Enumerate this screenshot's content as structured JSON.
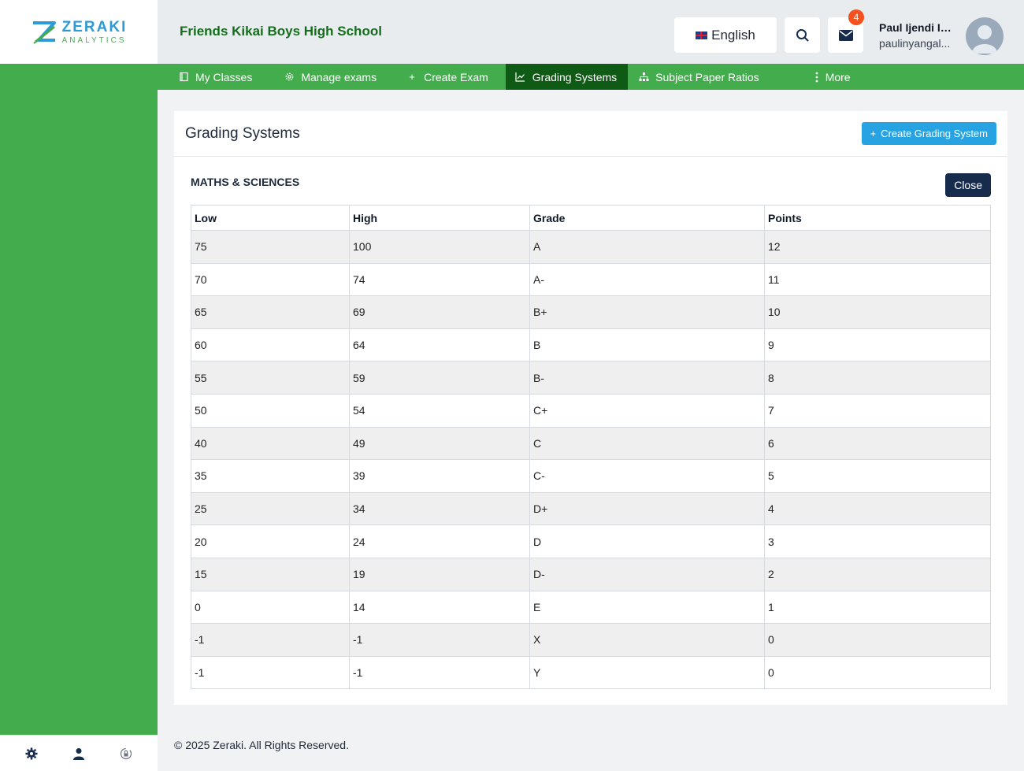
{
  "brand": {
    "name": "ZERAKI",
    "sub": "ANALYTICS"
  },
  "header": {
    "school_name": "Friends Kikai Boys High School",
    "language": "English",
    "notifications_count": "4",
    "user_name": "Paul Ijendi Iny...",
    "user_email": "paulinyangal..."
  },
  "nav": {
    "items": [
      {
        "label": "My Classes",
        "icon": "book-icon"
      },
      {
        "label": "Manage exams",
        "icon": "gear-icon"
      },
      {
        "label": "Create Exam",
        "icon": "plus-icon"
      },
      {
        "label": "Grading Systems",
        "icon": "chart-line-icon",
        "active": true
      },
      {
        "label": "Subject Paper Ratios",
        "icon": "sitemap-icon"
      },
      {
        "label": "More",
        "icon": "kebab-icon"
      }
    ]
  },
  "page": {
    "title": "Grading Systems",
    "create_button": "Create Grading System",
    "section_title": "MATHS & SCIENCES",
    "close_button": "Close"
  },
  "table": {
    "headers": [
      "Low",
      "High",
      "Grade",
      "Points"
    ],
    "rows": [
      [
        "75",
        "100",
        "A",
        "12"
      ],
      [
        "70",
        "74",
        "A-",
        "11"
      ],
      [
        "65",
        "69",
        "B+",
        "10"
      ],
      [
        "60",
        "64",
        "B",
        "9"
      ],
      [
        "55",
        "59",
        "B-",
        "8"
      ],
      [
        "50",
        "54",
        "C+",
        "7"
      ],
      [
        "40",
        "49",
        "C",
        "6"
      ],
      [
        "35",
        "39",
        "C-",
        "5"
      ],
      [
        "25",
        "34",
        "D+",
        "4"
      ],
      [
        "20",
        "24",
        "D",
        "3"
      ],
      [
        "15",
        "19",
        "D-",
        "2"
      ],
      [
        "0",
        "14",
        "E",
        "1"
      ],
      [
        "-1",
        "-1",
        "X",
        "0"
      ],
      [
        "-1",
        "-1",
        "Y",
        "0"
      ]
    ]
  },
  "footer": {
    "copyright": "© 2025 Zeraki. All Rights Reserved."
  },
  "colors": {
    "sidebar_green": "#43ad4d",
    "active_nav": "#0f5b16",
    "primary_blue": "#27a3e3",
    "dark_navy": "#172b4d"
  }
}
